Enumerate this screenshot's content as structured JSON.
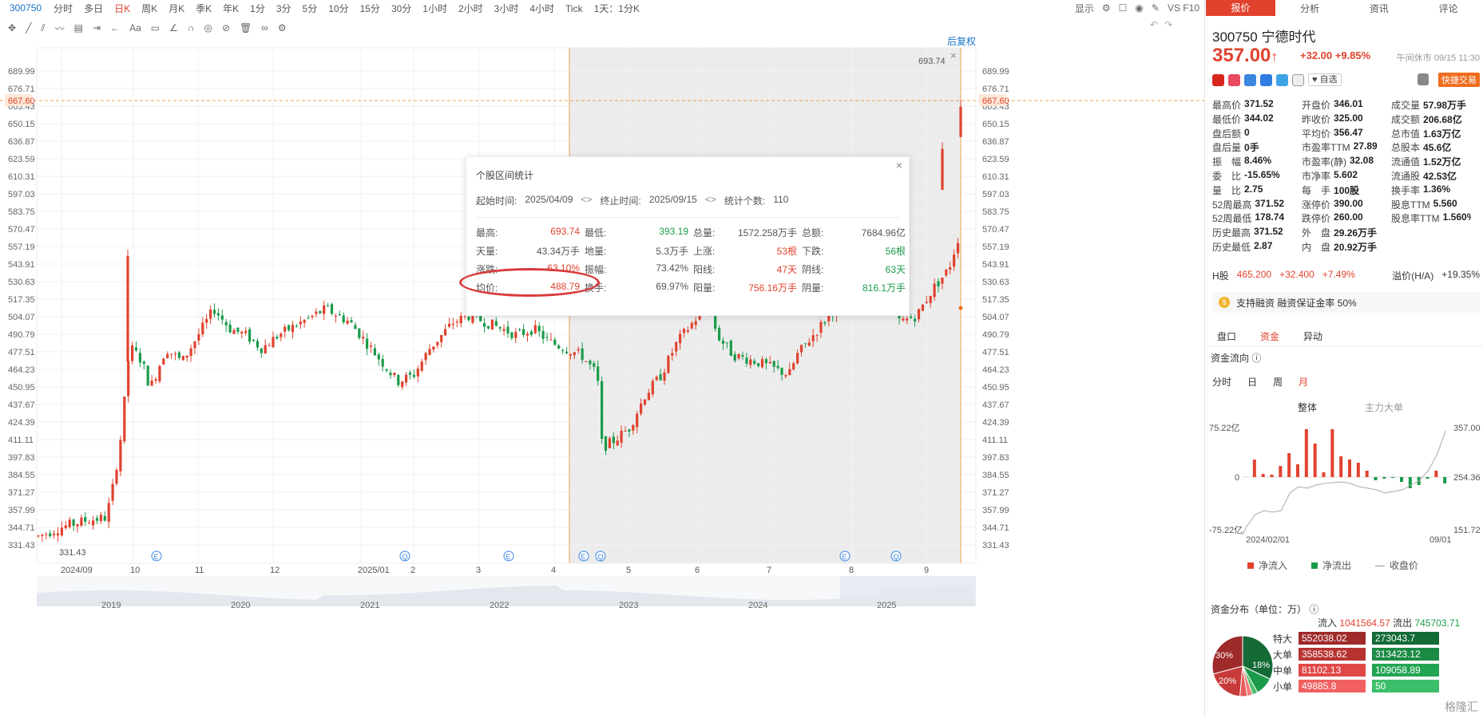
{
  "topbar": {
    "code": "300750",
    "periods": [
      "分时",
      "多日",
      "日K",
      "周K",
      "月K",
      "季K",
      "年K",
      "1分",
      "3分",
      "5分",
      "10分",
      "15分",
      "30分",
      "1小时",
      "2小时",
      "3小时",
      "4小时",
      "Tick",
      "1天：1分K"
    ],
    "active": "日K",
    "display_label": "显示",
    "right_text": "VS F10"
  },
  "toolbar": {
    "text_tool": "Aa"
  },
  "chart": {
    "restore_label": "后复权",
    "price_ticks": [
      "689.99",
      "676.71",
      "663.43",
      "650.15",
      "636.87",
      "623.59",
      "610.31",
      "597.03",
      "583.75",
      "570.47",
      "557.19",
      "543.91",
      "530.63",
      "517.35",
      "504.07",
      "490.79",
      "477.51",
      "464.23",
      "450.95",
      "437.67",
      "424.39",
      "411.11",
      "397.83",
      "384.55",
      "371.27",
      "357.99",
      "344.71",
      "331.43"
    ],
    "current_price_label": "667.60",
    "high_label": "693.74",
    "low_label": "331.43",
    "x_labels": [
      "2024/09",
      "10",
      "11",
      "12",
      "2025/01",
      "2",
      "3",
      "4",
      "5",
      "6",
      "7",
      "8",
      "9"
    ],
    "overview_years": [
      "2019",
      "2020",
      "2021",
      "2022",
      "2023",
      "2024",
      "2025"
    ],
    "event_markers": [
      "E",
      "Q",
      "E",
      "E",
      "Q",
      "E",
      "Q"
    ]
  },
  "chart_data": {
    "type": "candlestick",
    "y_range": [
      331.43,
      693.74
    ],
    "selection_range": [
      "2025/04/09",
      "2025/09/15"
    ],
    "period_high": 693.74,
    "period_low": 393.19,
    "current": 667.6
  },
  "popup": {
    "title": "个股区间统计",
    "start_label": "起始时间:",
    "start": "2025/04/09",
    "end_label": "终止时间:",
    "end": "2025/09/15",
    "count_label": "统计个数:",
    "count": "110",
    "stats": [
      {
        "l": "最高:",
        "v": "693.74",
        "c": "red"
      },
      {
        "l": "最低:",
        "v": "393.19",
        "c": "green"
      },
      {
        "l": "总量:",
        "v": "1572.258万手",
        "c": "plain"
      },
      {
        "l": "总额:",
        "v": "7684.96亿",
        "c": "plain"
      },
      {
        "l": "天量:",
        "v": "43.34万手",
        "c": "plain"
      },
      {
        "l": "地量:",
        "v": "5.3万手",
        "c": "plain"
      },
      {
        "l": "上涨:",
        "v": "53根",
        "c": "red"
      },
      {
        "l": "下跌:",
        "v": "56根",
        "c": "green"
      },
      {
        "l": "涨跌:",
        "v": "63.10%",
        "c": "red"
      },
      {
        "l": "振幅:",
        "v": "73.42%",
        "c": "plain"
      },
      {
        "l": "阳线:",
        "v": "47天",
        "c": "red"
      },
      {
        "l": "阴线:",
        "v": "63天",
        "c": "green"
      },
      {
        "l": "均价:",
        "v": "488.79",
        "c": "red"
      },
      {
        "l": "换手:",
        "v": "69.97%",
        "c": "plain"
      },
      {
        "l": "阳量:",
        "v": "756.16万手",
        "c": "red"
      },
      {
        "l": "阴量:",
        "v": "816.1万手",
        "c": "green"
      }
    ]
  },
  "right": {
    "tabs": [
      "报价",
      "分析",
      "资讯",
      "评论"
    ],
    "code": "300750",
    "name": "宁德时代",
    "price": "357.00",
    "change": "+32.00",
    "change_pct": "+9.85%",
    "status": "午间休市 09/15 11:30",
    "zixuan": "自选",
    "quick_trade": "快捷交易",
    "quotes": [
      [
        {
          "l": "最高价",
          "v": "371.52",
          "c": "red"
        },
        {
          "l": "开盘价",
          "v": "346.01",
          "c": "red"
        },
        {
          "l": "成交量",
          "v": "57.98万手",
          "c": "plain"
        }
      ],
      [
        {
          "l": "最低价",
          "v": "344.02",
          "c": "red"
        },
        {
          "l": "昨收价",
          "v": "325.00",
          "c": "plain"
        },
        {
          "l": "成交额",
          "v": "206.68亿",
          "c": "plain"
        }
      ],
      [
        {
          "l": "盘后额",
          "v": "0",
          "c": "plain"
        },
        {
          "l": "平均价",
          "v": "356.47",
          "c": "red"
        },
        {
          "l": "总市值",
          "v": "1.63万亿",
          "c": "plain"
        }
      ],
      [
        {
          "l": "盘后量",
          "v": "0手",
          "c": "plain"
        },
        {
          "l": "市盈率TTM",
          "v": "27.89",
          "c": "plain"
        },
        {
          "l": "总股本",
          "v": "45.6亿",
          "c": "plain"
        }
      ],
      [
        {
          "l": "振　幅",
          "v": "8.46%",
          "c": "plain"
        },
        {
          "l": "市盈率(静)",
          "v": "32.08",
          "c": "plain"
        },
        {
          "l": "流通值",
          "v": "1.52万亿",
          "c": "plain"
        }
      ],
      [
        {
          "l": "委　比",
          "v": "-15.65%",
          "c": "plain"
        },
        {
          "l": "市净率",
          "v": "5.602",
          "c": "plain"
        },
        {
          "l": "流通股",
          "v": "42.53亿",
          "c": "plain"
        }
      ],
      [
        {
          "l": "量　比",
          "v": "2.75",
          "c": "plain"
        },
        {
          "l": "每　手",
          "v": "100股",
          "c": "plain"
        },
        {
          "l": "换手率",
          "v": "1.36%",
          "c": "plain"
        }
      ],
      [
        {
          "l": "52周最高",
          "v": "371.52",
          "c": "red"
        },
        {
          "l": "涨停价",
          "v": "390.00",
          "c": "red"
        },
        {
          "l": "股息TTM",
          "v": "5.560",
          "c": "plain"
        }
      ],
      [
        {
          "l": "52周最低",
          "v": "178.74",
          "c": "green"
        },
        {
          "l": "跌停价",
          "v": "260.00",
          "c": "green"
        },
        {
          "l": "股息率TTM",
          "v": "1.560%",
          "c": "plain"
        }
      ],
      [
        {
          "l": "历史最高",
          "v": "371.52",
          "c": "red"
        },
        {
          "l": "外　盘",
          "v": "29.26万手",
          "c": "red"
        },
        {
          "l": "",
          "v": "",
          "c": "plain"
        }
      ],
      [
        {
          "l": "历史最低",
          "v": "2.87",
          "c": "green"
        },
        {
          "l": "内　盘",
          "v": "20.92万手",
          "c": "green"
        },
        {
          "l": "",
          "v": "",
          "c": "plain"
        }
      ]
    ],
    "h_share_label": "H股",
    "h_price": "465.200",
    "h_change": "+32.400",
    "h_pct": "+7.49%",
    "premium_label": "溢价(H/A)",
    "premium": "+19.35%",
    "margin_text": "支持融资 融资保证金率 50%",
    "subtabs": [
      "盘口",
      "资金",
      "异动"
    ],
    "flow_title": "资金流向",
    "flow_periods": [
      "分时",
      "日",
      "周",
      "月"
    ],
    "flow_modes": [
      "整体",
      "主力大单"
    ],
    "flow_axis": {
      "top_left": "75.22亿",
      "mid_left": "0",
      "bot_left": "-75.22亿",
      "top_right": "357.00",
      "mid_right": "254.36",
      "bot_right": "151.72",
      "x_start": "2024/02/01",
      "x_end": "09/01"
    },
    "legend": [
      "净流入",
      "净流出",
      "收盘价"
    ],
    "dist_title": "资金分布（单位：万）",
    "inflow_label": "流入",
    "inflow_total": "1041564.57",
    "outflow_label": "流出",
    "outflow_total": "745703.71",
    "pie_labels": [
      "30%",
      "20%",
      "18%"
    ],
    "dist": [
      {
        "name": "特大",
        "in": "552038.02",
        "out": "273043.7"
      },
      {
        "name": "大单",
        "in": "358538.62",
        "out": "313423.12"
      },
      {
        "name": "中单",
        "in": "81102.13",
        "out": "109058.89"
      },
      {
        "name": "小单",
        "in": "49885.8",
        "out": "50"
      }
    ],
    "watermark": "格隆汇"
  }
}
